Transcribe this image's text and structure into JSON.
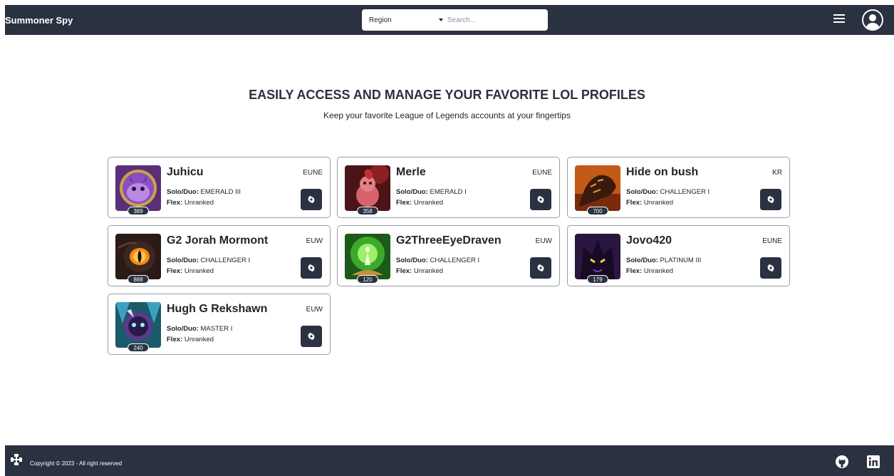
{
  "header": {
    "brand": "Summoner Spy",
    "region_select": "Region",
    "search_placeholder": "Search...",
    "icons": [
      "menu-icon",
      "user-avatar-icon"
    ]
  },
  "hero": {
    "title": "EASILY ACCESS AND MANAGE YOUR FAVORITE LOL PROFILES",
    "subtitle": "Keep your favorite League of Legends accounts at your fingertips"
  },
  "labels": {
    "solo": "Solo/Duo:",
    "flex": "Flex:"
  },
  "profiles": [
    {
      "name": "Juhicu",
      "region": "EUNE",
      "level": "389",
      "solo": "EMERALD III",
      "flex": "Unranked"
    },
    {
      "name": "Merle",
      "region": "EUNE",
      "level": "358",
      "solo": "EMERALD I",
      "flex": "Unranked"
    },
    {
      "name": "Hide on bush",
      "region": "KR",
      "level": "700",
      "solo": "CHALLENGER I",
      "flex": "Unranked"
    },
    {
      "name": "G2 Jorah Mormont",
      "region": "EUW",
      "level": "888",
      "solo": "CHALLENGER I",
      "flex": "Unranked"
    },
    {
      "name": "G2ThreeEyeDraven",
      "region": "EUW",
      "level": "120",
      "solo": "CHALLENGER I",
      "flex": "Unranked"
    },
    {
      "name": "Jovo420",
      "region": "EUNE",
      "level": "179",
      "solo": "PLATINUM III",
      "flex": "Unranked"
    },
    {
      "name": "Hugh G Rekshawn",
      "region": "EUW",
      "level": "240",
      "solo": "MASTER I",
      "flex": "Unranked"
    }
  ],
  "footer": {
    "copyright": "Copyright © 2023 - All right reserved",
    "icons": [
      "puzzle-logo-icon",
      "github-icon",
      "linkedin-icon"
    ]
  },
  "colors": {
    "header_bg": "#2a3140",
    "card_border": "#9aa0a6",
    "button_bg": "#2a3140"
  }
}
